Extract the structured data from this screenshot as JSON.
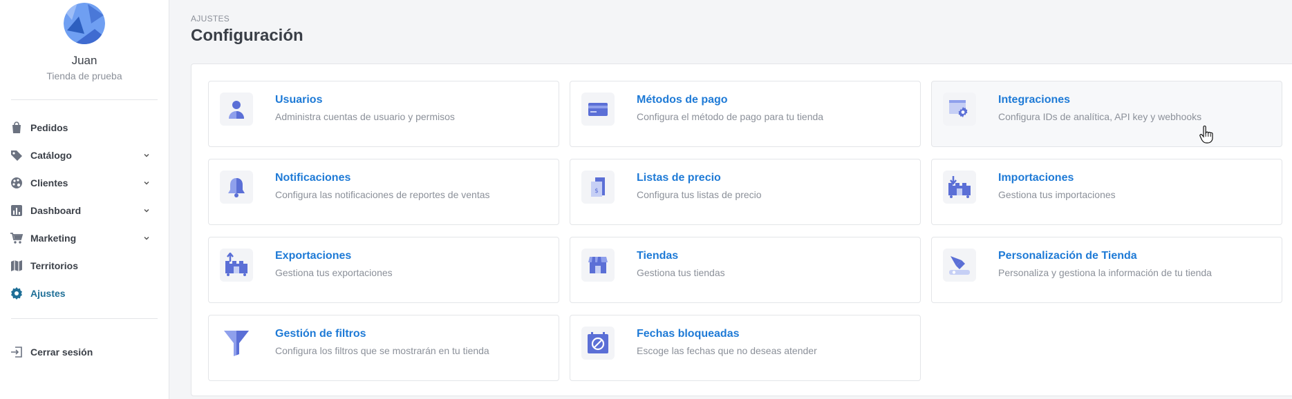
{
  "sidebar": {
    "user_name": "Juan",
    "store_name": "Tienda de prueba",
    "items": [
      {
        "label": "Pedidos",
        "icon": "shopping-bag-icon",
        "has_chevron": false
      },
      {
        "label": "Catálogo",
        "icon": "tag-icon",
        "has_chevron": true
      },
      {
        "label": "Clientes",
        "icon": "palette-icon",
        "has_chevron": true
      },
      {
        "label": "Dashboard",
        "icon": "chart-icon",
        "has_chevron": true
      },
      {
        "label": "Marketing",
        "icon": "cart-icon",
        "has_chevron": true
      },
      {
        "label": "Territorios",
        "icon": "map-icon",
        "has_chevron": false
      },
      {
        "label": "Ajustes",
        "icon": "gear-icon",
        "has_chevron": false,
        "active": true
      }
    ],
    "logout_label": "Cerrar sesión"
  },
  "header": {
    "breadcrumb": "AJUSTES",
    "title": "Configuración"
  },
  "cards": [
    {
      "title": "Usuarios",
      "desc": "Administra cuentas de usuario y permisos",
      "icon": "user-icon"
    },
    {
      "title": "Métodos de pago",
      "desc": "Configura el método de pago para tu tienda",
      "icon": "credit-card-icon"
    },
    {
      "title": "Integraciones",
      "desc": "Configura IDs de analítica, API key y webhooks",
      "icon": "browser-gear-icon"
    },
    {
      "title": "Notificaciones",
      "desc": "Configura las notificaciones de reportes de ventas",
      "icon": "bell-icon"
    },
    {
      "title": "Listas de precio",
      "desc": "Configura tus listas de precio",
      "icon": "price-list-icon"
    },
    {
      "title": "Importaciones",
      "desc": "Gestiona tus importaciones",
      "icon": "import-icon"
    },
    {
      "title": "Exportaciones",
      "desc": "Gestiona tus exportaciones",
      "icon": "export-icon"
    },
    {
      "title": "Tiendas",
      "desc": "Gestiona tus tiendas",
      "icon": "store-icon"
    },
    {
      "title": "Personalización de Tienda",
      "desc": "Personaliza y gestiona la información de tu tienda",
      "icon": "brush-icon"
    },
    {
      "title": "Gestión de filtros",
      "desc": "Configura los filtros que se mostrarán en tu tienda",
      "icon": "funnel-icon"
    },
    {
      "title": "Fechas bloqueadas",
      "desc": "Escoge las fechas que no deseas atender",
      "icon": "blocked-calendar-icon"
    }
  ],
  "colors": {
    "accent": "#1e7ad6",
    "icon_primary": "#5b6fd6",
    "icon_light": "#8fa0ec",
    "active_nav": "#1f6f97"
  }
}
